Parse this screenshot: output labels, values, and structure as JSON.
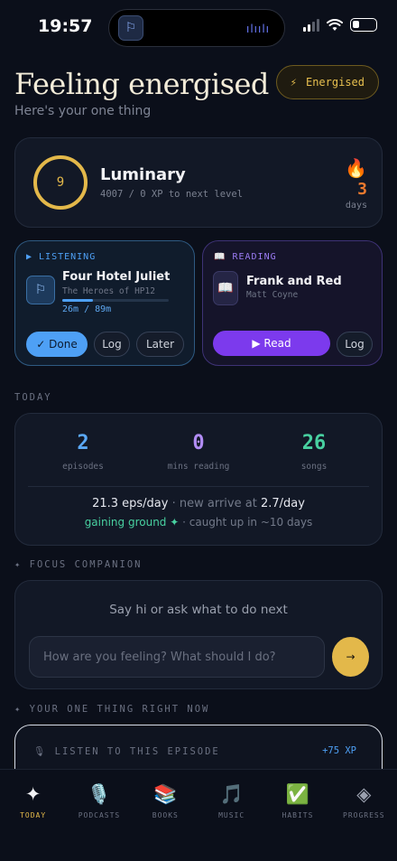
{
  "status": {
    "time": "19:57"
  },
  "header": {
    "title": "Feeling energised",
    "subtitle": "Here's your one thing",
    "mood_icon": "⚡",
    "mood_label": "Energised"
  },
  "level": {
    "value": "9",
    "rank": "Luminary",
    "xp_text": "4007 / 0 XP to next level",
    "streak_icon": "🔥",
    "streak_value": "3",
    "streak_unit": "days"
  },
  "listening": {
    "kicker": "▶ LISTENING",
    "title": "Four Hotel Juliet",
    "subtitle": "The Heroes of HP12",
    "progress_text": "26m / 89m",
    "progress": 0.292,
    "done_label": "✓ Done",
    "log_label": "Log",
    "later_label": "Later"
  },
  "reading": {
    "kicker": "📖 READING",
    "cover_icon": "📖",
    "title": "Frank and Red",
    "author": "Matt Coyne",
    "read_label": "▶ Read",
    "log_label": "Log"
  },
  "today": {
    "section": "TODAY",
    "stats": [
      {
        "value": "2",
        "label": "episodes",
        "color": "#5aa8f5"
      },
      {
        "value": "0",
        "label": "mins reading",
        "color": "#b18cf4"
      },
      {
        "value": "26",
        "label": "songs",
        "color": "#48d0a0"
      }
    ],
    "rate_main": "21.3 eps/day",
    "rate_sep": " · new arrive at ",
    "rate_new": "2.7/day",
    "gain_status": "gaining ground ✦",
    "gain_rest": " · caught up in ~10 days"
  },
  "focus": {
    "section": "✦ FOCUS COMPANION",
    "prompt": "Say hi or ask what to do next",
    "placeholder": "How are you feeling? What should I do?",
    "send_icon": "→"
  },
  "one_thing": {
    "section": "✦ YOUR ONE THING RIGHT NOW",
    "label": "🎙 LISTEN TO THIS EPISODE",
    "xp": "+75 XP"
  },
  "nav": [
    {
      "icon": "✦",
      "label": "TODAY",
      "active": true
    },
    {
      "icon": "🎙️",
      "label": "PODCASTS",
      "active": false
    },
    {
      "icon": "📚",
      "label": "BOOKS",
      "active": false
    },
    {
      "icon": "🎵",
      "label": "MUSIC",
      "active": false
    },
    {
      "icon": "✅",
      "label": "HABITS",
      "active": false
    },
    {
      "icon": "◈",
      "label": "PROGRESS",
      "active": false
    }
  ],
  "colors": {
    "accent": "#e3b84a",
    "listen": "#4ea0f5",
    "read": "#7c3aed",
    "gain": "#48d0a0",
    "streak": "#f07a2e"
  }
}
